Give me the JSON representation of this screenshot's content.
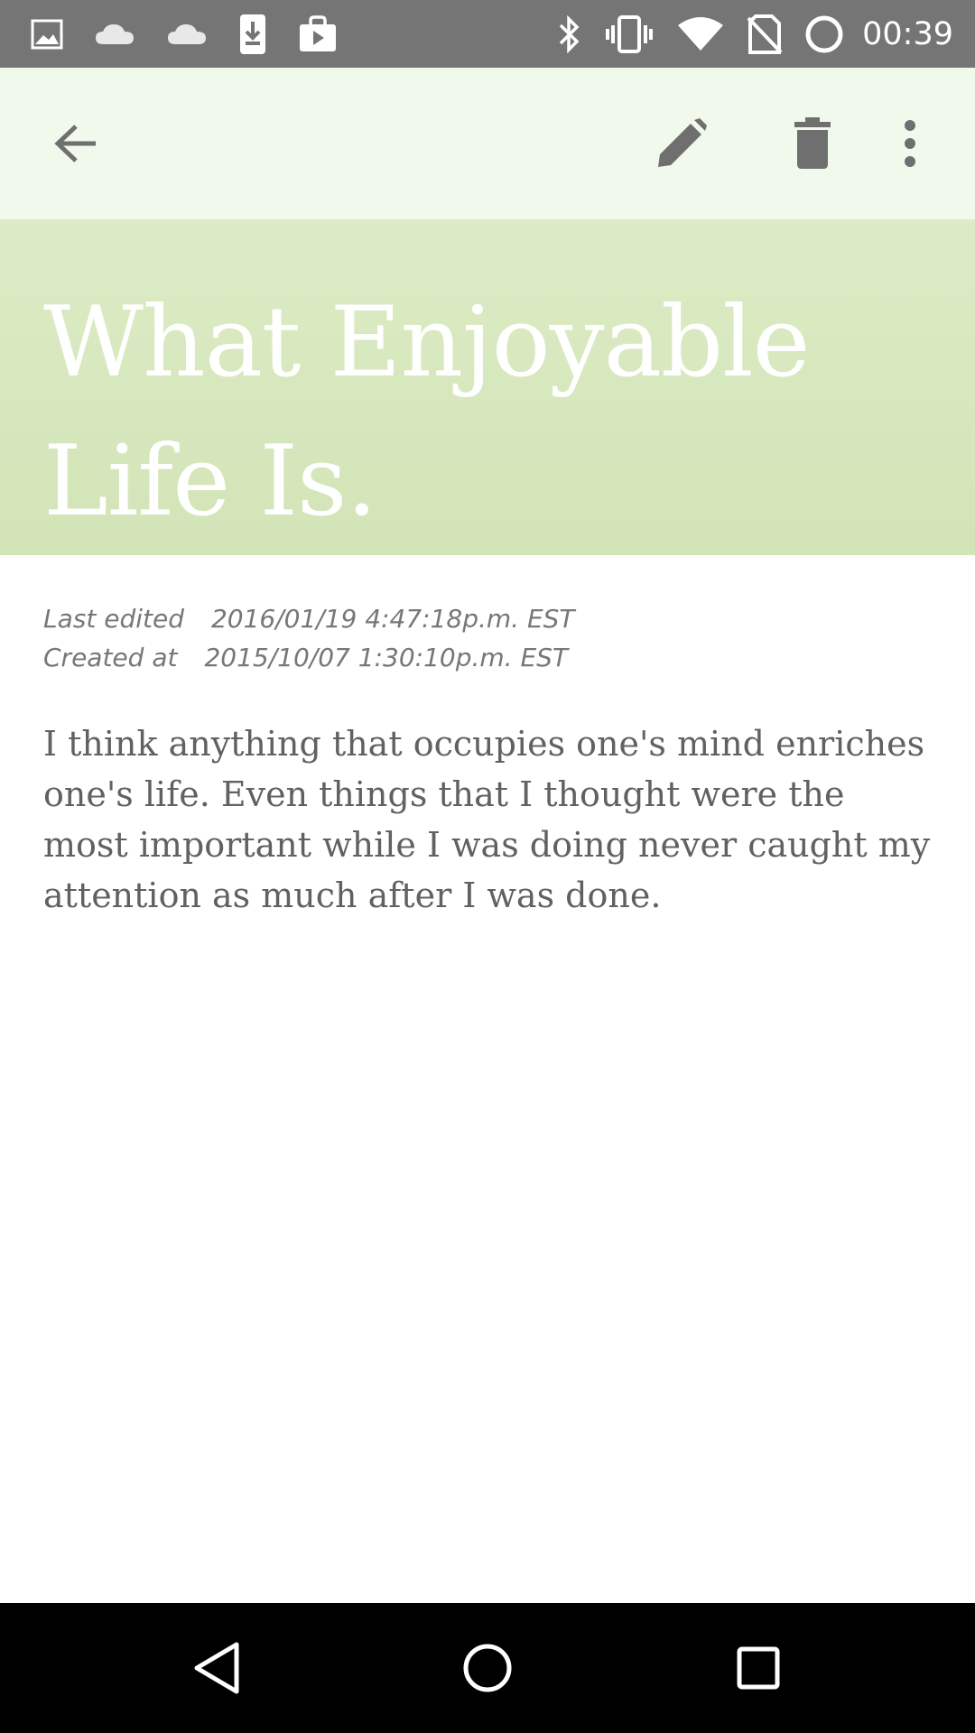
{
  "status_bar": {
    "time": "00:39",
    "left_icons": [
      "gallery-icon",
      "cloud-icon",
      "cloud-icon",
      "download-icon",
      "play-store-icon"
    ],
    "right_icons": [
      "bluetooth-icon",
      "vibrate-icon",
      "wifi-icon",
      "no-sim-icon",
      "circle-indicator-icon"
    ]
  },
  "toolbar": {
    "back_icon": "arrow-back-icon",
    "actions": [
      "edit-icon",
      "delete-icon",
      "more-vert-icon"
    ]
  },
  "note": {
    "title": "What Enjoyable Life Is.",
    "last_edited_label": "Last edited",
    "last_edited_value": "2016/01/19 4:47:18p.m. EST",
    "created_label": "Created at",
    "created_value": "2015/10/07 1:30:10p.m. EST",
    "body": "I think anything that occupies one's mind enriches one's life. Even things that I thought were the most important while I was doing never caught my attention as much after I was done."
  },
  "nav_bar": {
    "buttons": [
      "nav-back-icon",
      "nav-home-icon",
      "nav-recents-icon"
    ]
  },
  "colors": {
    "status_bar": "#757575",
    "toolbar": "#f1f8ec",
    "title_banner": "#d8e8bf",
    "icon_gray": "#707070",
    "body_text": "#616161"
  }
}
